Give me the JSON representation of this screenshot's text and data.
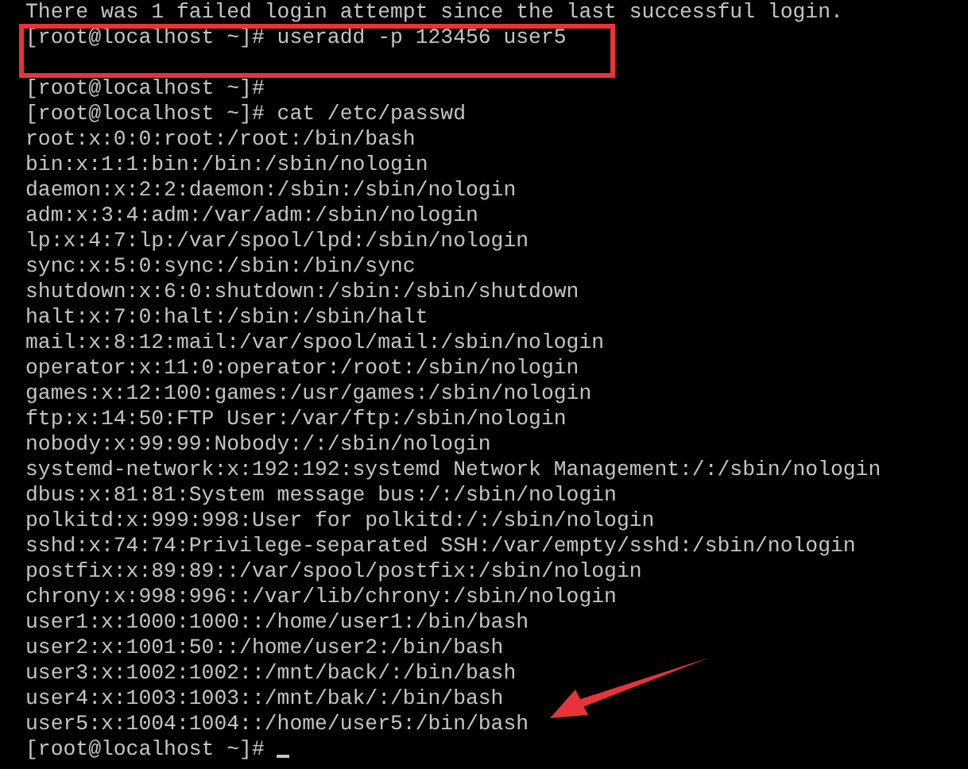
{
  "terminal": {
    "lines": [
      {
        "kind": "text",
        "text": "There was 1 failed login attempt since the last successful login.",
        "highlighted": false,
        "pointed": false
      },
      {
        "kind": "text",
        "text": "[root@localhost ~]# useradd -p 123456 user5",
        "highlighted": true,
        "pointed": false
      },
      {
        "kind": "blank"
      },
      {
        "kind": "text",
        "text": "[root@localhost ~]#",
        "highlighted": false,
        "pointed": false
      },
      {
        "kind": "text",
        "text": "[root@localhost ~]# cat /etc/passwd",
        "highlighted": false,
        "pointed": false
      },
      {
        "kind": "text",
        "text": "root:x:0:0:root:/root:/bin/bash",
        "highlighted": false,
        "pointed": false
      },
      {
        "kind": "text",
        "text": "bin:x:1:1:bin:/bin:/sbin/nologin",
        "highlighted": false,
        "pointed": false
      },
      {
        "kind": "text",
        "text": "daemon:x:2:2:daemon:/sbin:/sbin/nologin",
        "highlighted": false,
        "pointed": false
      },
      {
        "kind": "text",
        "text": "adm:x:3:4:adm:/var/adm:/sbin/nologin",
        "highlighted": false,
        "pointed": false
      },
      {
        "kind": "text",
        "text": "lp:x:4:7:lp:/var/spool/lpd:/sbin/nologin",
        "highlighted": false,
        "pointed": false
      },
      {
        "kind": "text",
        "text": "sync:x:5:0:sync:/sbin:/bin/sync",
        "highlighted": false,
        "pointed": false
      },
      {
        "kind": "text",
        "text": "shutdown:x:6:0:shutdown:/sbin:/sbin/shutdown",
        "highlighted": false,
        "pointed": false
      },
      {
        "kind": "text",
        "text": "halt:x:7:0:halt:/sbin:/sbin/halt",
        "highlighted": false,
        "pointed": false
      },
      {
        "kind": "text",
        "text": "mail:x:8:12:mail:/var/spool/mail:/sbin/nologin",
        "highlighted": false,
        "pointed": false
      },
      {
        "kind": "text",
        "text": "operator:x:11:0:operator:/root:/sbin/nologin",
        "highlighted": false,
        "pointed": false
      },
      {
        "kind": "text",
        "text": "games:x:12:100:games:/usr/games:/sbin/nologin",
        "highlighted": false,
        "pointed": false
      },
      {
        "kind": "text",
        "text": "ftp:x:14:50:FTP User:/var/ftp:/sbin/nologin",
        "highlighted": false,
        "pointed": false
      },
      {
        "kind": "text",
        "text": "nobody:x:99:99:Nobody:/:/sbin/nologin",
        "highlighted": false,
        "pointed": false
      },
      {
        "kind": "text",
        "text": "systemd-network:x:192:192:systemd Network Management:/:/sbin/nologin",
        "highlighted": false,
        "pointed": false
      },
      {
        "kind": "text",
        "text": "dbus:x:81:81:System message bus:/:/sbin/nologin",
        "highlighted": false,
        "pointed": false
      },
      {
        "kind": "text",
        "text": "polkitd:x:999:998:User for polkitd:/:/sbin/nologin",
        "highlighted": false,
        "pointed": false
      },
      {
        "kind": "text",
        "text": "sshd:x:74:74:Privilege-separated SSH:/var/empty/sshd:/sbin/nologin",
        "highlighted": false,
        "pointed": false
      },
      {
        "kind": "text",
        "text": "postfix:x:89:89::/var/spool/postfix:/sbin/nologin",
        "highlighted": false,
        "pointed": false
      },
      {
        "kind": "text",
        "text": "chrony:x:998:996::/var/lib/chrony:/sbin/nologin",
        "highlighted": false,
        "pointed": false
      },
      {
        "kind": "text",
        "text": "user1:x:1000:1000::/home/user1:/bin/bash",
        "highlighted": false,
        "pointed": false
      },
      {
        "kind": "text",
        "text": "user2:x:1001:50::/home/user2:/bin/bash",
        "highlighted": false,
        "pointed": false
      },
      {
        "kind": "text",
        "text": "user3:x:1002:1002::/mnt/back/:/bin/bash",
        "highlighted": false,
        "pointed": false
      },
      {
        "kind": "text",
        "text": "user4:x:1003:1003::/mnt/bak/:/bin/bash",
        "highlighted": false,
        "pointed": false
      },
      {
        "kind": "text",
        "text": "user5:x:1004:1004::/home/user5:/bin/bash",
        "highlighted": false,
        "pointed": true
      },
      {
        "kind": "prompt",
        "text": "[root@localhost ~]#",
        "highlighted": false,
        "pointed": false
      }
    ]
  }
}
